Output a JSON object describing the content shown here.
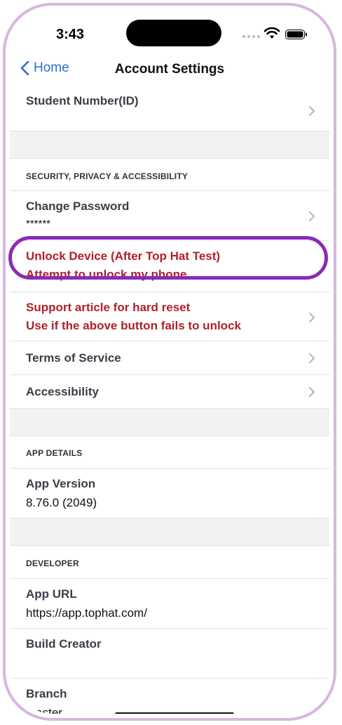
{
  "status": {
    "time": "3:43"
  },
  "nav": {
    "back_label": "Home",
    "title": "Account Settings"
  },
  "rows": {
    "student_number": "Student Number(ID)",
    "security_header": "SECURITY, PRIVACY & ACCESSIBILITY",
    "change_password": {
      "title": "Change Password",
      "value": "******"
    },
    "unlock_device": {
      "title": "Unlock Device (After Top Hat Test)",
      "subtitle": "Attempt to unlock my phone"
    },
    "support_article": {
      "title": "Support article for hard reset",
      "subtitle": "Use if the above button fails to unlock"
    },
    "terms": "Terms of Service",
    "accessibility": "Accessibility",
    "app_details_header": "APP DETAILS",
    "app_version": {
      "title": "App Version",
      "value": "8.76.0 (2049)"
    },
    "developer_header": "DEVELOPER",
    "app_url": {
      "title": "App URL",
      "value": "https://app.tophat.com/"
    },
    "build_creator": {
      "title": "Build Creator"
    },
    "branch": {
      "title": "Branch",
      "value": "master"
    }
  },
  "colors": {
    "accent": "#2f6fce",
    "danger": "#b0202a",
    "highlight": "#8a2bb8"
  }
}
